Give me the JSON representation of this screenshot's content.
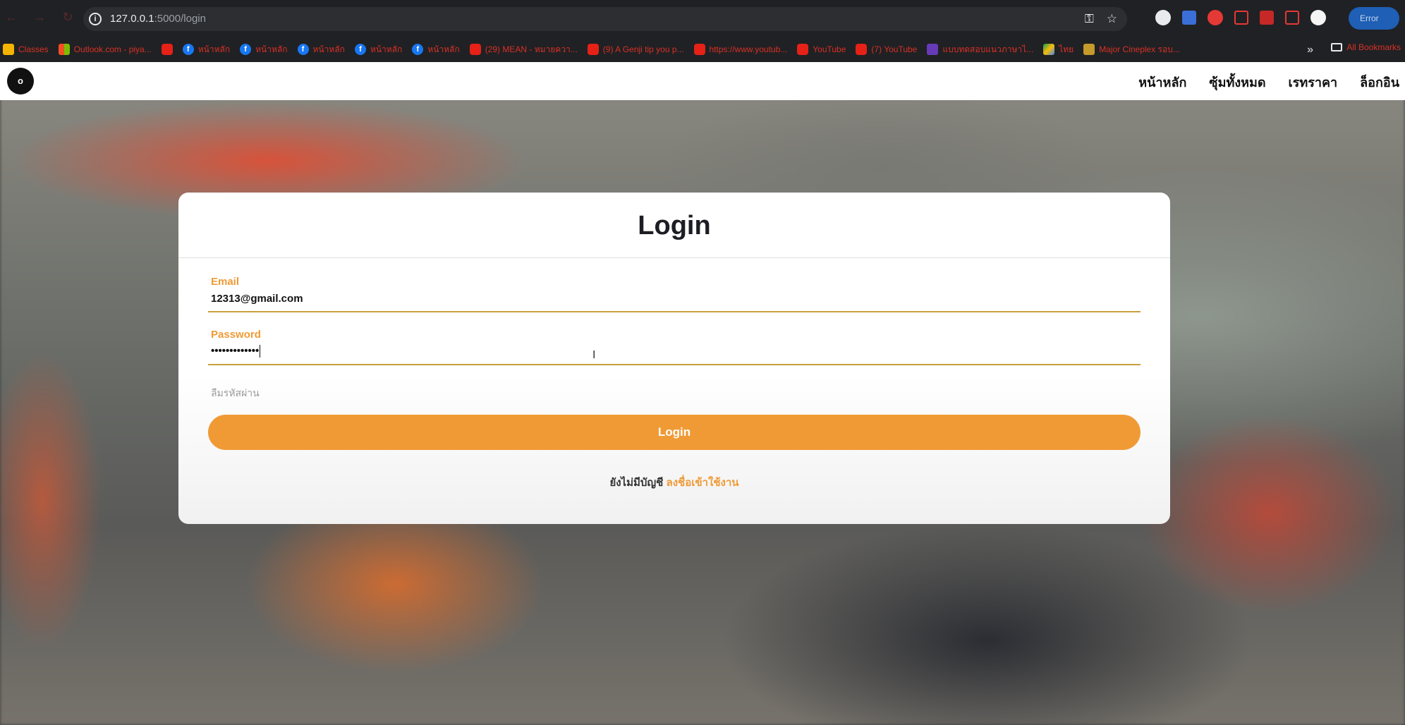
{
  "browser": {
    "url_host": "127.0.0.1",
    "url_path": ":5000/login",
    "profile_label": "Error"
  },
  "bookmarks": [
    {
      "icon": "classes-icon",
      "label": "Classes"
    },
    {
      "icon": "outlook-icon",
      "label": "Outlook.com - piya..."
    },
    {
      "icon": "youtube-icon",
      "label": ""
    },
    {
      "icon": "facebook-icon",
      "label": "หน้าหลัก"
    },
    {
      "icon": "facebook-icon",
      "label": "หน้าหลัก"
    },
    {
      "icon": "facebook-icon",
      "label": "หน้าหลัก"
    },
    {
      "icon": "facebook-icon",
      "label": "หน้าหลัก"
    },
    {
      "icon": "facebook-icon",
      "label": "หน้าหลัก"
    },
    {
      "icon": "youtube-icon",
      "label": "(29) MEAN - หมายควา..."
    },
    {
      "icon": "youtube-icon",
      "label": "(9) A Genji tip you p..."
    },
    {
      "icon": "youtube-icon",
      "label": "https://www.youtub..."
    },
    {
      "icon": "youtube-icon",
      "label": "YouTube"
    },
    {
      "icon": "youtube-icon",
      "label": "(7) YouTube"
    },
    {
      "icon": "forms-icon",
      "label": "แบบทดสอบแนวภาษาไ..."
    },
    {
      "icon": "drive-icon",
      "label": "ไทย"
    },
    {
      "icon": "major-icon",
      "label": "Major Cineplex รอบ..."
    }
  ],
  "all_bookmarks_label": "All Bookmarks",
  "site": {
    "logo_text": "o",
    "nav": [
      "หน้าหลัก",
      "ซุ้มทั้งหมด",
      "เรทราคา",
      "ล็อกอิน"
    ]
  },
  "login": {
    "title": "Login",
    "email_label": "Email",
    "email_value": "12313@gmail.com",
    "password_label": "Password",
    "password_value": "•••••••••••••",
    "forgot_label": "ลืมรหัสผ่าน",
    "submit_label": "Login",
    "signup_prompt": "ยังไม่มีบัญชี",
    "signup_link": "ลงชื่อเข้าใช้งาน"
  },
  "colors": {
    "accent": "#f09a36",
    "title": "#1d1d24",
    "underline": "#c9a13c"
  }
}
